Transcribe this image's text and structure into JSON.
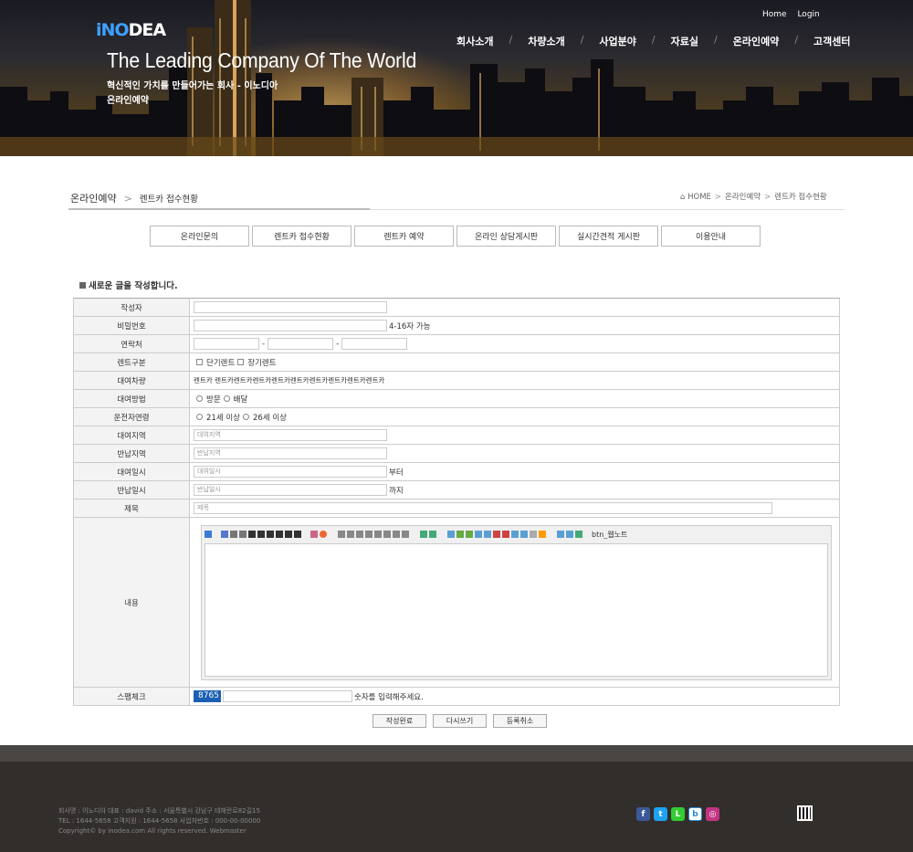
{
  "header": {
    "logo_main": "iNO",
    "logo_accent": "DEA",
    "title": "The Leading Company Of The World",
    "subtitle": "혁신적인 가치를 만들어가는 회사 - 이노디아",
    "section": "온라인예약",
    "top_links": [
      "Home",
      "Login"
    ],
    "nav": [
      "회사소개",
      "차량소개",
      "사업분야",
      "자료실",
      "온라인예약",
      "고객센터"
    ]
  },
  "location": {
    "title": "온라인예약",
    "current": "렌트카 접수현황",
    "breadcrumb": [
      "HOME",
      "온라인예약",
      "렌트카 접수현황"
    ]
  },
  "tabs": [
    "온라인문의",
    "렌트카 접수현황",
    "렌트카 예약",
    "온라인 상담게시판",
    "실시간견적 게시판",
    "이용안내"
  ],
  "write_title": "새로운 글을 작성합니다.",
  "form": {
    "author_label": "작성자",
    "password_label": "비밀번호",
    "password_hint": "4-16자 가능",
    "phone_label": "연락처",
    "phone_sep": "-",
    "rent_type_label": "렌트구분",
    "rent_type_options": [
      "단기렌트",
      "장기렌트"
    ],
    "car_label": "대여차량",
    "car_value": "렌트카 렌트카렌트카렌트카렌트카렌트카렌트카렌트카렌트카렌트카",
    "method_label": "대여방법",
    "method_options": [
      "방문",
      "배달"
    ],
    "driver_age_label": "운전자연령",
    "driver_age_options": [
      "21세 이상",
      "26세 이상"
    ],
    "rent_area_label": "대여지역",
    "rent_area_placeholder": "대여지역",
    "return_area_label": "반납지역",
    "return_area_placeholder": "반납지역",
    "rent_date_label": "대여일시",
    "rent_date_placeholder": "대여일시",
    "rent_date_suffix": "부터",
    "return_date_label": "반납일시",
    "return_date_placeholder": "반납일시",
    "return_date_suffix": "까지",
    "subject_label": "제목",
    "subject_placeholder": "제목",
    "content_label": "내용",
    "editor_extra": "btn_웹노트",
    "spam_label": "스팸체크",
    "spam_code": "8765",
    "spam_hint": "숫자를 입력해주세요."
  },
  "buttons": {
    "submit": "작성완료",
    "rewrite": "다시쓰기",
    "cancel": "등록취소"
  },
  "footer": {
    "line1": "회사명 : 이노디아    대표 : david    주소 : 서울특별시 강남구 테헤란로82길15",
    "line2": "TEL : 1644-5658    고객지원 : 1644-5658    사업자번호 : 000-00-00000",
    "line3": "Copyright© by inodea.com All rights reserved.    Webmaster"
  },
  "social_icons": [
    "facebook-icon",
    "twitter-icon",
    "line-icon",
    "blog-icon",
    "instagram-icon"
  ],
  "colors": {
    "accent": "#1a5fb4",
    "footer_bg": "#322e2c"
  }
}
